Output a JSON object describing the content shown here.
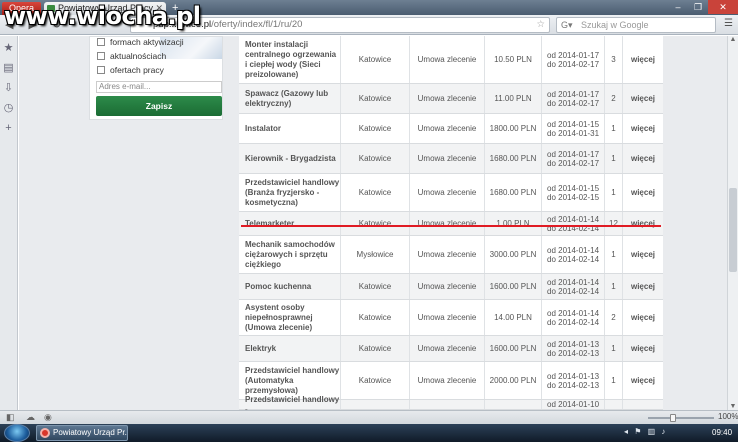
{
  "watermark": "www.wiocha.pl",
  "browser": {
    "opera_button": "Opera",
    "tab_title": "Powiatowy Urząd Pracy...",
    "url_prefix": "pup",
    "url_host": "...owice.pl",
    "url_path": "/oferty/index/fl/1/ru/20",
    "search_placeholder": "Szukaj w Google",
    "zoom": "100%"
  },
  "newsletter": {
    "options": [
      "formach aktywizacji",
      "aktualnościach",
      "ofertach pracy"
    ],
    "email_placeholder": "Adres e-mail...",
    "submit_label": "Zapisz"
  },
  "listing": {
    "more_label": "więcej",
    "rows": [
      {
        "title": "Monter instalacji centralnego ogrzewania i ciepłej wody (Sieci preizolowane)",
        "city": "Katowice",
        "type": "Umowa zlecenie",
        "salary": "10.50 PLN",
        "from": "od 2014-01-17",
        "to": "do 2014-02-17",
        "count": "3"
      },
      {
        "title": "Spawacz (Gazowy lub elektryczny)",
        "city": "Katowice",
        "type": "Umowa zlecenie",
        "salary": "11.00 PLN",
        "from": "od 2014-01-17",
        "to": "do 2014-02-17",
        "count": "2"
      },
      {
        "title": "Instalator",
        "city": "Katowice",
        "type": "Umowa zlecenie",
        "salary": "1800.00 PLN",
        "from": "od 2014-01-15",
        "to": "do 2014-01-31",
        "count": "1"
      },
      {
        "title": "Kierownik - Brygadzista",
        "city": "Katowice",
        "type": "Umowa zlecenie",
        "salary": "1680.00 PLN",
        "from": "od 2014-01-17",
        "to": "do 2014-02-17",
        "count": "1"
      },
      {
        "title": "Przedstawiciel handlowy (Branża fryzjersko - kosmetyczna)",
        "city": "Katowice",
        "type": "Umowa zlecenie",
        "salary": "1680.00 PLN",
        "from": "od 2014-01-15",
        "to": "do 2014-02-15",
        "count": "1"
      },
      {
        "title": "Telemarketer",
        "city": "Katowice",
        "type": "Umowa zlecenie",
        "salary": "1.00 PLN",
        "from": "od 2014-01-14",
        "to": "do 2014-02-14",
        "count": "12"
      },
      {
        "title": "Mechanik samochodów ciężarowych i sprzętu ciężkiego",
        "city": "Mysłowice",
        "type": "Umowa zlecenie",
        "salary": "3000.00 PLN",
        "from": "od 2014-01-14",
        "to": "do 2014-02-14",
        "count": "1"
      },
      {
        "title": "Pomoc kuchenna",
        "city": "Katowice",
        "type": "Umowa zlecenie",
        "salary": "1600.00 PLN",
        "from": "od 2014-01-14",
        "to": "do 2014-02-14",
        "count": "1"
      },
      {
        "title": "Asystent osoby niepełnosprawnej (Umowa zlecenie)",
        "city": "Katowice",
        "type": "Umowa zlecenie",
        "salary": "14.00 PLN",
        "from": "od 2014-01-14",
        "to": "do 2014-02-14",
        "count": "2"
      },
      {
        "title": "Elektryk",
        "city": "Katowice",
        "type": "Umowa zlecenie",
        "salary": "1600.00 PLN",
        "from": "od 2014-01-13",
        "to": "do 2014-02-13",
        "count": "1"
      },
      {
        "title": "Przedstawiciel handlowy (Automatyka przemysłowa)",
        "city": "Katowice",
        "type": "Umowa zlecenie",
        "salary": "2000.00 PLN",
        "from": "od 2014-01-13",
        "to": "do 2014-02-13",
        "count": "1"
      },
      {
        "title": "Przedstawiciel handlowy -",
        "city": "",
        "type": "",
        "salary": "",
        "from": "od 2014-01-10",
        "to": "",
        "count": ""
      }
    ]
  },
  "taskbar": {
    "window_title": "Powiatowy Urząd Pr...",
    "clock": "09:40"
  },
  "colors": {
    "highlight_line": "#e01b24",
    "submit_green": "#1b6c34"
  }
}
